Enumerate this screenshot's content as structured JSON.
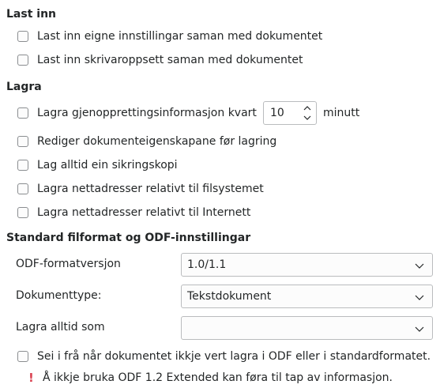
{
  "load": {
    "title": "Last inn",
    "items": [
      "Last inn eigne innstillingar saman med dokumentet",
      "Last inn skrivaroppsett saman med dokumentet"
    ]
  },
  "save": {
    "title": "Lagra",
    "autorecovery_label": "Lagra gjenopprettingsinformasjon kvart",
    "autorecovery_value": "10",
    "autorecovery_unit": "minutt",
    "items": [
      "Rediger dokumenteigenskapane før lagring",
      "Lag alltid ein sikringskopi",
      "Lagra nettadresser relativt til filsystemet",
      "Lagra nettadresser relativt til Internett"
    ]
  },
  "format": {
    "title": "Standard filformat og ODF-innstillingar",
    "odf_version_label": "ODF-formatversjon",
    "odf_version_value": "1.0/1.1",
    "doctype_label": "Dokumenttype:",
    "doctype_value": "Tekstdokument",
    "always_save_label": "Lagra alltid som",
    "always_save_value": "",
    "warn_checkbox": "Sei i frå når dokumentet ikkje vert lagra i ODF eller i standardformatet.",
    "warning": "Å ikkje bruka ODF 1.2 Extended kan føra til tap av informasjon."
  },
  "colors": {
    "warning_icon": "#da4453",
    "text": "#232627"
  }
}
